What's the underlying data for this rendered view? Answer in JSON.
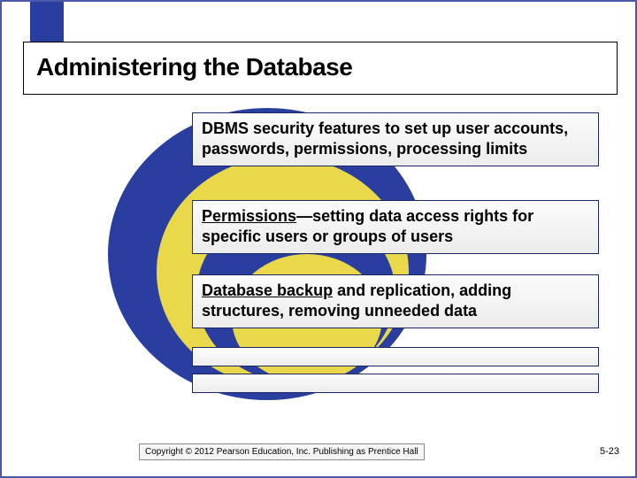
{
  "title": "Administering the Database",
  "bullets": [
    {
      "text": "DBMS security features to set up user accounts, passwords, permissions, processing limits"
    },
    {
      "pre": "Permissions",
      "post": "—setting data access rights for specific users or groups of users"
    },
    {
      "pre": "Database backup",
      "post": " and replication, adding structures, removing unneeded data"
    }
  ],
  "copyright": "Copyright © 2012 Pearson Education, Inc. Publishing as Prentice Hall",
  "page_number": "5-23"
}
